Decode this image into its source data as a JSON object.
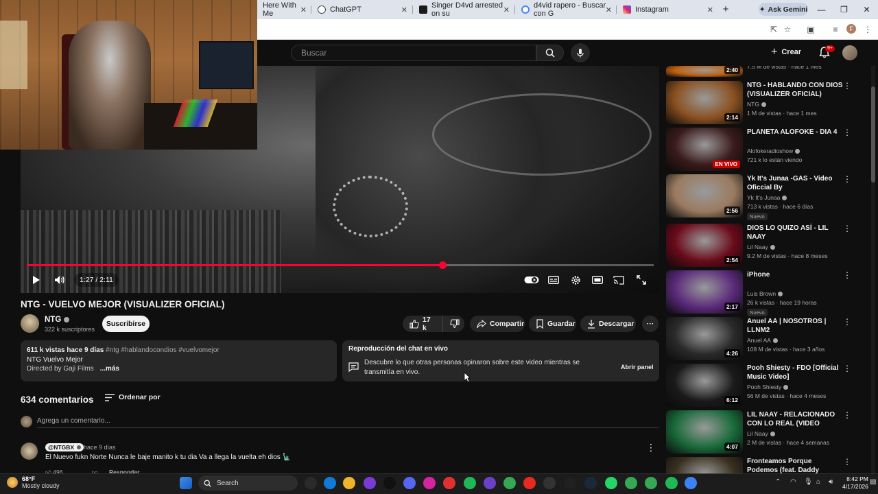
{
  "browser": {
    "tabs": [
      {
        "label": "Here With Me",
        "favicon_color": "#5f6368"
      },
      {
        "label": "ChatGPT",
        "favicon_color": "#444444"
      },
      {
        "label": "Singer D4vd arrested on su",
        "favicon_color": "#1a1a1a"
      },
      {
        "label": "d4vid rapero - Buscar con G",
        "favicon_color": "#4285f4"
      },
      {
        "label": "Instagram",
        "favicon_color": "#d6249f"
      }
    ],
    "new_tab": "+",
    "ask_gemini": "Ask Gemini",
    "profile_initial": "F"
  },
  "youtube": {
    "search_placeholder": "Buscar",
    "create_label": "Crear",
    "notifications_badge": "9+",
    "accent_color": "#ff0033"
  },
  "player": {
    "time_display": "1:27 / 2:11",
    "progress_fraction": 0.663
  },
  "video": {
    "title": "NTG - VUELVO MEJOR (VISUALIZER OFICIAL)",
    "channel": "NTG",
    "subscribers": "322 k suscriptores",
    "subscribe_label": "Suscribirse",
    "likes": "17 k",
    "share_label": "Compartir",
    "save_label": "Guardar",
    "download_label": "Descargar",
    "more_label": "···"
  },
  "description": {
    "stats": "611 k vistas  hace 9 días",
    "tags": "#ntg #hablandocondios #vuelvomejor",
    "line1": "NTG Vuelvo Mejor",
    "line2": "Directed by Gaji Films",
    "more": "...más"
  },
  "chat_replay": {
    "title": "Reproducción del chat en vivo",
    "text": "Descubre lo que otras personas opinaron sobre este video mientras se transmitía en vivo.",
    "open_label": "Abrir panel"
  },
  "comments": {
    "count": "634 comentarios",
    "sort_label": "Ordenar por",
    "add_placeholder": "Agrega un comentario...",
    "items": [
      {
        "author": "@NTGBX",
        "time": "hace 9 días",
        "text": "El Nuevo fukn Norte Nunca le baje manito k tu dia Va a llega la vuelta eh dios 🗽",
        "likes": "496",
        "reply_label": "Responder"
      }
    ]
  },
  "sidebar": {
    "items": [
      {
        "title": "",
        "channel": "",
        "meta": "7.5 M de vistas · hace 1 mes",
        "duration": "2:40",
        "badge": "",
        "thumb_color": "#c06010"
      },
      {
        "title": "NTG - HABLANDO CON DIOS (VISUALIZER OFICIAL)",
        "channel": "NTG",
        "meta": "1 M de vistas · hace 1 mes",
        "duration": "2:14",
        "badge": "",
        "thumb_color": "#8a5020"
      },
      {
        "title": "PLANETA ALOFOKE - DIA 4",
        "channel": "Alofokeradioshow",
        "meta": "721 k lo están viendo",
        "duration": "EN VIVO",
        "badge": "",
        "thumb_color": "#3a1a1a"
      },
      {
        "title": "Yk It's Junaa -GAS - Video Oficcial By @RodrigoFilmsDir",
        "channel": "Yk It's Junaa",
        "meta": "713 k vistas · hace 6 días",
        "duration": "2:56",
        "badge": "Nuevo",
        "thumb_color": "#9a7a60"
      },
      {
        "title": "DIOS LO QUIZO ASÍ - LIL NAAY",
        "channel": "Lil Naay",
        "meta": "9.2 M de vistas · hace 8 meses",
        "duration": "2:54",
        "badge": "",
        "thumb_color": "#6a0a1a"
      },
      {
        "title": "iPhone",
        "channel": "Luis Brown",
        "meta": "26 k vistas · hace 19 horas",
        "duration": "2:17",
        "badge": "Nuevo",
        "thumb_color": "#5a2a7a"
      },
      {
        "title": "Anuel AA | NOSOTROS | LLNM2",
        "channel": "Anuel AA",
        "meta": "108 M de vistas · hace 3 años",
        "duration": "4:26",
        "badge": "",
        "thumb_color": "#2a2a2a"
      },
      {
        "title": "Pooh Shiesty - FDO [Official Music Video]",
        "channel": "Pooh Shiesty",
        "meta": "56 M de vistas · hace 4 meses",
        "duration": "6:12",
        "badge": "",
        "thumb_color": "#1a1a1a"
      },
      {
        "title": "LIL NAAY - RELACIONADO CON LO REAL (VIDEO OFICIAL)",
        "channel": "Lil Naay",
        "meta": "2 M de vistas · hace 4 semanas",
        "duration": "4:07",
        "badge": "",
        "thumb_color": "#1a6a3a"
      },
      {
        "title": "Fronteamos Porque Podemos (feat. Daddy Yankee, Yandel &",
        "channel": "",
        "meta": "",
        "duration": "",
        "badge": "",
        "thumb_color": "#3a3020"
      }
    ]
  },
  "taskbar": {
    "temperature": "68°F",
    "condition": "Mostly cloudy",
    "search_label": "Search",
    "time": "8:42 PM",
    "date": "4/17/2026"
  }
}
